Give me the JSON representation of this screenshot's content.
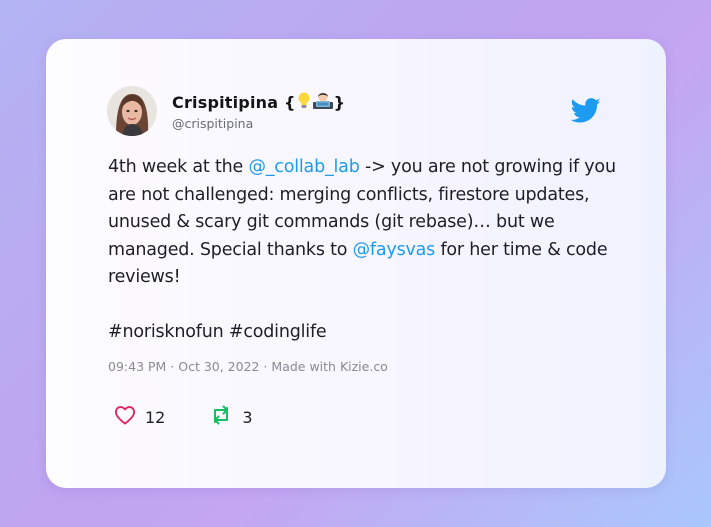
{
  "author": {
    "display_name": "Crispitipina",
    "handle": "@crispitipina"
  },
  "tweet": {
    "line1_pre": "4th week at the ",
    "mention1": "@_collab_lab",
    "line1_post": " -> you are not growing if you are not challenged: merging conflicts, firestore updates, unused & scary git commands (git rebase)… but we managed. Special thanks to ",
    "mention2": "@faysvas",
    "line1_end": " for her time & code reviews!",
    "hashtags": "#norisknofun #codinglife"
  },
  "meta": "09:43 PM · Oct 30, 2022 · Made with Kizie.co",
  "stats": {
    "likes": "12",
    "retweets": "3"
  },
  "icons": {
    "like": "heart-icon",
    "retweet": "retweet-icon",
    "brand": "twitter-bird-icon"
  },
  "colors": {
    "mention": "#1d9bf0",
    "like": "#e0245e",
    "retweet": "#17bf63",
    "twitter": "#1d9bf0"
  }
}
